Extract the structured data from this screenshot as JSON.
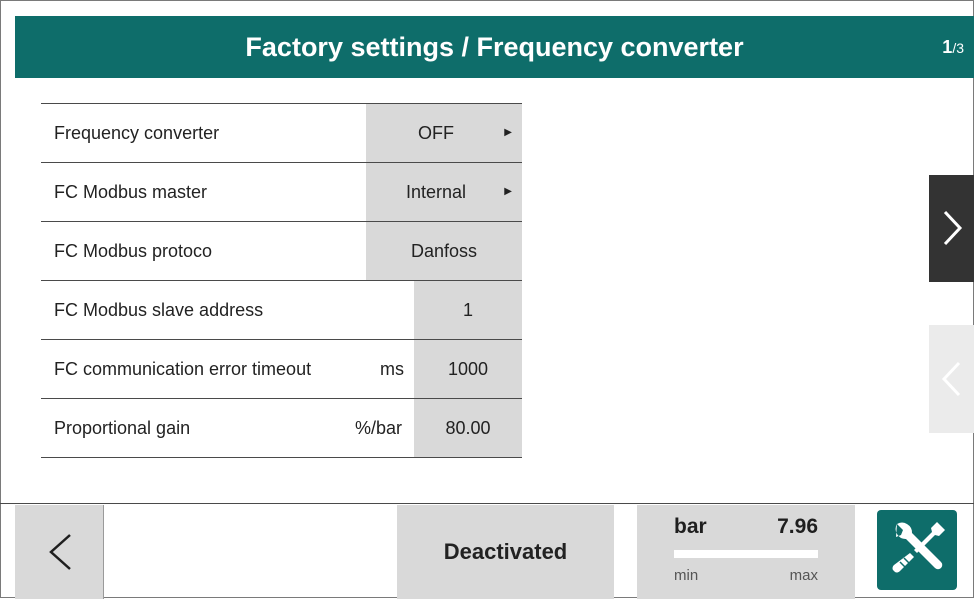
{
  "header": {
    "title": "Factory settings / Frequency converter",
    "page_current": "1",
    "page_total": "/3"
  },
  "rows": [
    {
      "label": "Frequency converter",
      "unit": "",
      "value": "OFF",
      "dropdown": true
    },
    {
      "label": "FC Modbus master",
      "unit": "",
      "value": "Internal",
      "dropdown": true
    },
    {
      "label": "FC Modbus protoco",
      "unit": "",
      "value": "Danfoss",
      "dropdown": false
    },
    {
      "label": "FC Modbus slave address",
      "unit": "",
      "value": "1",
      "dropdown": false
    },
    {
      "label": "FC communication error timeout",
      "unit": "ms",
      "value": "1000",
      "dropdown": false
    },
    {
      "label": "Proportional gain",
      "unit": "%/bar",
      "value": "80.00",
      "dropdown": false
    }
  ],
  "dropdown_icon": "triangle-right-icon",
  "side_nav": {
    "next_icon": "chevron-right-icon",
    "prev_icon": "chevron-left-icon"
  },
  "footer": {
    "back_icon": "chevron-left-icon",
    "status": "Deactivated",
    "gauge": {
      "unit": "bar",
      "value": "7.96",
      "min_label": "min",
      "max_label": "max",
      "fill_fraction": 1.0
    },
    "tools_icon": "wrench-screwdriver-icon"
  },
  "colors": {
    "accent": "#0e6d6a",
    "panel": "#d9d9d9",
    "nav_dark": "#333333"
  }
}
